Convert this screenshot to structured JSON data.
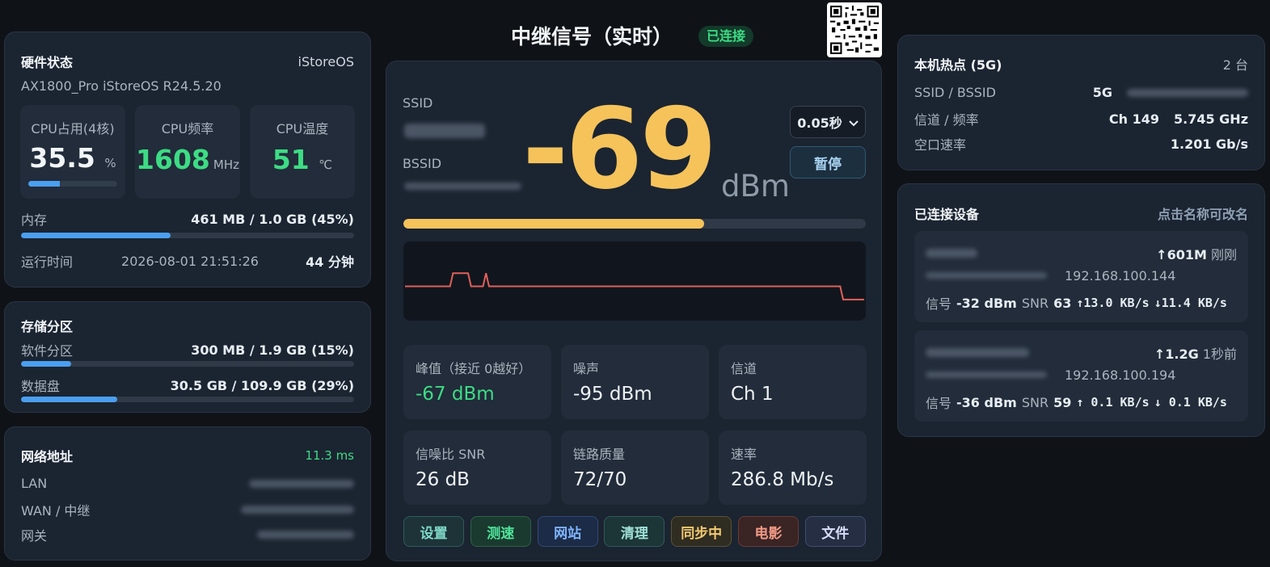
{
  "page": {
    "title": "中继信号（实时）",
    "status": "已连接"
  },
  "hardware": {
    "title": "硬件状态",
    "os": "iStoreOS",
    "model": "AX1800_Pro iStoreOS R24.5.20",
    "cpu_usage": {
      "label": "CPU占用(4核)",
      "value": "35.5",
      "unit": "%",
      "percent": 35.5
    },
    "cpu_freq": {
      "label": "CPU频率",
      "value": "1608",
      "unit": "MHz"
    },
    "cpu_temp": {
      "label": "CPU温度",
      "value": "51",
      "unit": "℃"
    },
    "memory": {
      "label": "内存",
      "value": "461 MB / 1.0 GB (45%)",
      "percent": 45
    },
    "uptime": {
      "label": "运行时间",
      "timestamp": "2026-08-01 21:51:26",
      "value": "44 分钟"
    }
  },
  "storage": {
    "title": "存储分区",
    "software": {
      "label": "软件分区",
      "value": "300 MB / 1.9 GB (15%)",
      "percent": 15
    },
    "data": {
      "label": "数据盘",
      "value": "30.5 GB / 109.9 GB (29%)",
      "percent": 29
    }
  },
  "network": {
    "title": "网络地址",
    "latency": "11.3 ms",
    "lan_label": "LAN",
    "wan_label": "WAN / 中继",
    "gw_label": "网关"
  },
  "signal": {
    "ssid_label": "SSID",
    "bssid_label": "BSSID",
    "value": "-69",
    "unit": "dBm",
    "bar_percent": 65,
    "interval": "0.05秒",
    "pause_label": "暂停",
    "trace": [
      -72,
      -72,
      -72,
      -72,
      -72,
      -72,
      -72,
      -72,
      -72,
      -72,
      -72,
      -72,
      -72,
      -72,
      -72,
      -72,
      -67,
      -67,
      -67,
      -67,
      -67,
      -67,
      -72,
      -72,
      -72,
      -72,
      -72,
      -67,
      -72,
      -72,
      -72,
      -72,
      -72,
      -72,
      -72,
      -72,
      -72,
      -72,
      -72,
      -72,
      -72,
      -72,
      -72,
      -72,
      -72,
      -72,
      -72,
      -72,
      -72,
      -72,
      -72,
      -72,
      -72,
      -72,
      -72,
      -72,
      -72,
      -72,
      -72,
      -72,
      -72,
      -72,
      -72,
      -72,
      -72,
      -72,
      -72,
      -72,
      -72,
      -72,
      -72,
      -72,
      -72,
      -72,
      -72,
      -72,
      -72,
      -72,
      -72,
      -72,
      -72,
      -72,
      -72,
      -72,
      -72,
      -72,
      -72,
      -72,
      -72,
      -72,
      -72,
      -72,
      -72,
      -72,
      -72,
      -72,
      -72,
      -72,
      -72,
      -72,
      -72,
      -72,
      -72,
      -72,
      -72,
      -72,
      -72,
      -72,
      -72,
      -72,
      -72,
      -72,
      -72,
      -72,
      -72,
      -72,
      -72,
      -72,
      -72,
      -72,
      -72,
      -72,
      -72,
      -72,
      -72,
      -72,
      -72,
      -72,
      -72,
      -72,
      -72,
      -72,
      -72,
      -72,
      -72,
      -72,
      -72,
      -72,
      -72,
      -72,
      -72,
      -72,
      -72,
      -72,
      -72,
      -72,
      -77,
      -77,
      -77,
      -77,
      -77,
      -77,
      -77,
      -77
    ],
    "stats": [
      {
        "label": "峰值（接近 0越好）",
        "value": "-67 dBm",
        "color": "#3ddc84"
      },
      {
        "label": "噪声",
        "value": "-95 dBm",
        "color": "#eef2f6"
      },
      {
        "label": "信道",
        "value": "Ch 1",
        "color": "#eef2f6"
      },
      {
        "label": "信噪比 SNR",
        "value": "26 dB",
        "color": "#eef2f6"
      },
      {
        "label": "链路质量",
        "value": "72/70",
        "color": "#eef2f6"
      },
      {
        "label": "速率",
        "value": "286.8 Mb/s",
        "color": "#eef2f6"
      }
    ]
  },
  "buttons": [
    {
      "label": "设置",
      "color": "#7fd8c8",
      "bg": "#1d3338",
      "border": "#2f5b5c"
    },
    {
      "label": "测速",
      "color": "#4ee39a",
      "bg": "#1b3a2f",
      "border": "#2d6148"
    },
    {
      "label": "网站",
      "color": "#7fb4ff",
      "bg": "#1c2b46",
      "border": "#2f4a78"
    },
    {
      "label": "清理",
      "color": "#9fe0d6",
      "bg": "#1c3537",
      "border": "#2f5a5a"
    },
    {
      "label": "同步中",
      "color": "#f3c971",
      "bg": "#2f2c22",
      "border": "#5c5234"
    },
    {
      "label": "电影",
      "color": "#f19a86",
      "bg": "#3a2424",
      "border": "#6a3a36"
    },
    {
      "label": "文件",
      "color": "#d9def8",
      "bg": "#262e44",
      "border": "#414c6f"
    }
  ],
  "hotspot": {
    "title": "本机热点 (5G)",
    "count": "2 台",
    "ssid_label": "SSID / BSSID",
    "ssid_value": "5G",
    "channel_label": "信道 / 频率",
    "channel_value": "Ch 149",
    "freq_value": "5.745 GHz",
    "rate_label": "空口速率",
    "rate_value": "1.201 Gb/s"
  },
  "devices": {
    "title": "已连接设备",
    "hint": "点击名称可改名",
    "items": [
      {
        "traffic": "↑601M",
        "time": "刚刚",
        "ip": "192.168.100.144",
        "signal_label": "信号",
        "signal": "-32 dBm",
        "snr_label": "SNR",
        "snr": "63",
        "up": "↑13.0 KB/s",
        "down": "↓11.4 KB/s"
      },
      {
        "traffic": "↑1.2G",
        "time": "1秒前",
        "ip": "192.168.100.194",
        "signal_label": "信号",
        "signal": "-36 dBm",
        "snr_label": "SNR",
        "snr": "59",
        "up": "↑ 0.1 KB/s",
        "down": "↓ 0.1 KB/s"
      }
    ]
  },
  "colors": {
    "accent": "#f5c35a",
    "green": "#3ddc84",
    "bar_blue": "#4b9ff0",
    "trace": "#e0605a"
  },
  "icons": {
    "qr": "qr-code-icon",
    "chevron": "chevron-down-icon"
  }
}
